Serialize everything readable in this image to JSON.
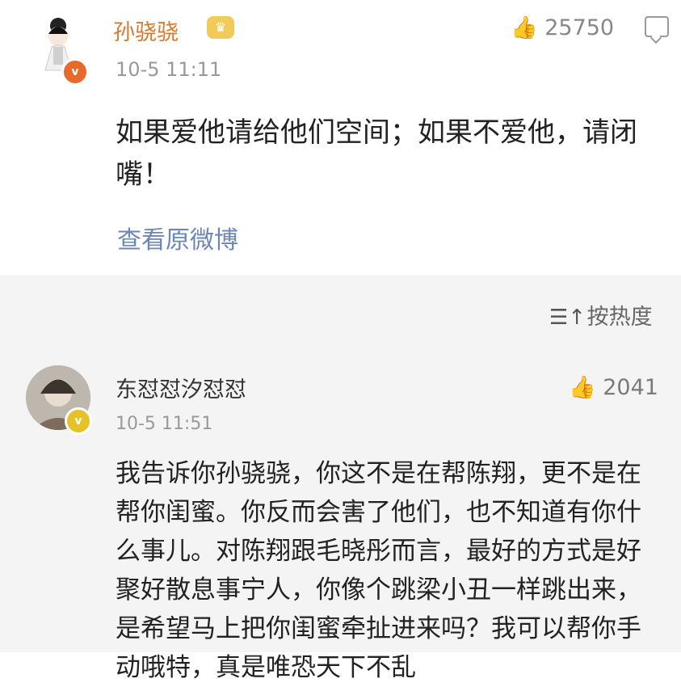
{
  "post": {
    "author": "孙骁骁",
    "timestamp": "10-5 11:11",
    "likes": "25750",
    "content": "如果爱他请给他们空间；如果不爱他，请闭嘴！",
    "view_original": "查看原微博",
    "icons": [
      "thumbs-up-icon",
      "comment-icon",
      "crown-badge-icon",
      "verified-badge-icon"
    ]
  },
  "comments_header": {
    "sort_label": "按热度",
    "sort_icon": "sort-icon"
  },
  "comment": {
    "author": "东怼怼汐怼怼",
    "timestamp": "10-5 11:51",
    "likes": "2041",
    "content": "我告诉你孙骁骁，你这不是在帮陈翔，更不是在帮你闺蜜。你反而会害了他们，也不知道有你什么事儿。对陈翔跟毛晓彤而言，最好的方式是好聚好散息事宁人，你像个跳梁小丑一样跳出来，是希望马上把你闺蜜牵扯进来吗？我可以帮你手动哦特，真是唯恐天下不乱"
  }
}
